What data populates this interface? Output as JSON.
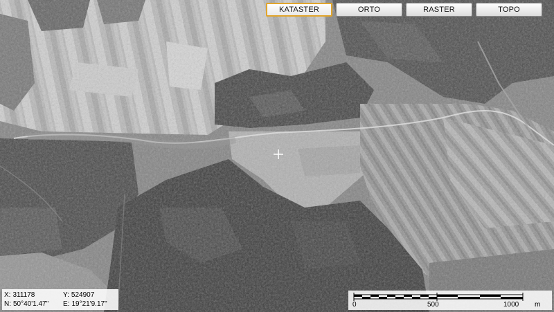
{
  "layers": {
    "buttons": [
      {
        "label": "KATASTER",
        "active": true
      },
      {
        "label": "ORTO",
        "active": false
      },
      {
        "label": "RASTER",
        "active": false
      },
      {
        "label": "TOPO",
        "active": false
      }
    ]
  },
  "coordinates": {
    "x_key": "X:",
    "x_value": "311178",
    "y_key": "Y:",
    "y_value": "524907",
    "n_key": "N:",
    "n_value": "50°40'1.47\"",
    "e_key": "E:",
    "e_value": "19°21'9.17\""
  },
  "scale": {
    "labels": [
      "0",
      "500",
      "1000"
    ],
    "unit": "m"
  },
  "icons": {
    "crosshair": "crosshair-icon"
  }
}
